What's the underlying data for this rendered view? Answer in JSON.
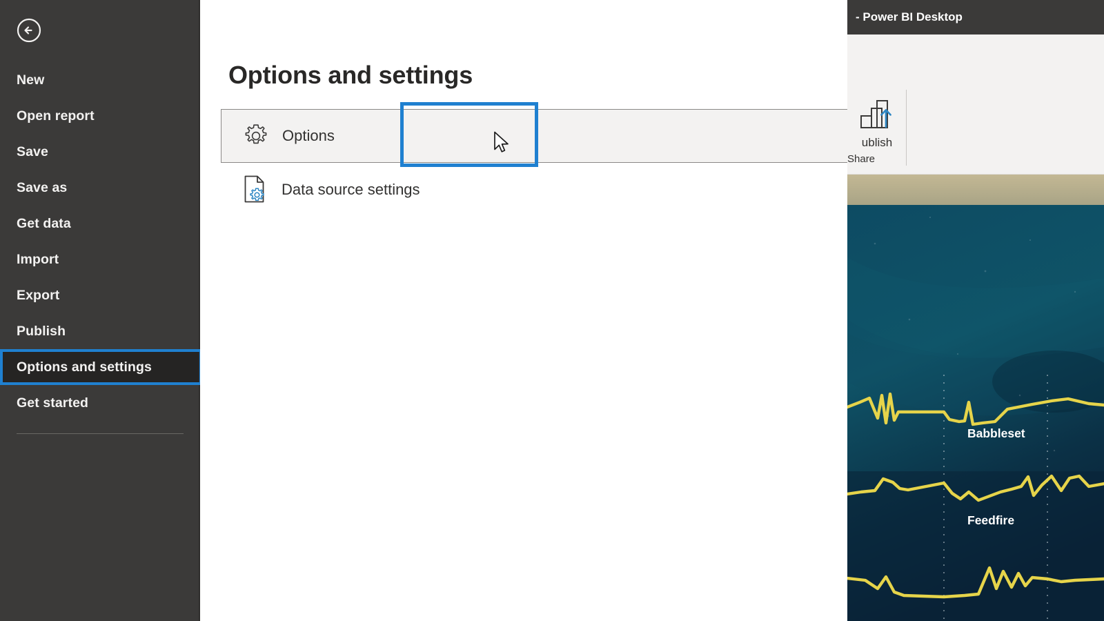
{
  "sidebar": {
    "back_icon": "back-arrow-circle-icon",
    "items": [
      {
        "label": "New",
        "selected": false
      },
      {
        "label": "Open report",
        "selected": false
      },
      {
        "label": "Save",
        "selected": false
      },
      {
        "label": "Save as",
        "selected": false
      },
      {
        "label": "Get data",
        "selected": false
      },
      {
        "label": "Import",
        "selected": false
      },
      {
        "label": "Export",
        "selected": false
      },
      {
        "label": "Publish",
        "selected": false
      },
      {
        "label": "Options and settings",
        "selected": true
      },
      {
        "label": "Get started",
        "selected": false
      }
    ],
    "selected_index": 8,
    "highlight_color": "#1f80d0",
    "background_color": "#3b3a39",
    "selected_background_color": "#252423"
  },
  "main": {
    "title": "Options and settings",
    "commands": [
      {
        "label": "Options",
        "icon": "gear-icon",
        "hovered": true,
        "annotated": true
      },
      {
        "label": "Data source settings",
        "icon": "document-gear-icon",
        "hovered": false,
        "annotated": false
      }
    ],
    "cursor": "arrow-pointer"
  },
  "right_panel": {
    "titlebar": {
      "text": "- Power BI Desktop",
      "background_color": "#3b3a39"
    },
    "ribbon": {
      "button_label": "ublish",
      "button_icon": "publish-bar-chart-up-arrow-icon",
      "group_label": "Share",
      "accent_color": "#2e87c4"
    },
    "canvas": {
      "background_top_color": "#b9ae8c",
      "background_color": "#0c3a4e",
      "line_color": "#e6d44a",
      "charts": [
        {
          "label": "Babbleset"
        },
        {
          "label": "Feedfire"
        },
        {
          "label": ""
        }
      ]
    }
  },
  "chart_data": {
    "type": "line",
    "title": "",
    "xlabel": "",
    "ylabel": "",
    "legend_position": "inline-label",
    "grid": false,
    "series": [
      {
        "name": "Babbleset",
        "values": [
          52,
          55,
          50,
          62,
          38,
          70,
          40,
          66,
          45,
          48,
          44,
          46,
          45,
          44,
          58,
          62,
          64,
          68,
          70,
          69,
          66
        ]
      },
      {
        "name": "Feedfire",
        "values": [
          30,
          31,
          33,
          44,
          38,
          36,
          35,
          55,
          46,
          40,
          48,
          42,
          46,
          50,
          52,
          55,
          70,
          40,
          58,
          72,
          60
        ]
      },
      {
        "name": "",
        "values": [
          40,
          41,
          38,
          34,
          30,
          50,
          36,
          34,
          33,
          33,
          34,
          35,
          36,
          72,
          50,
          78,
          52,
          60,
          44,
          62,
          58
        ]
      }
    ]
  }
}
